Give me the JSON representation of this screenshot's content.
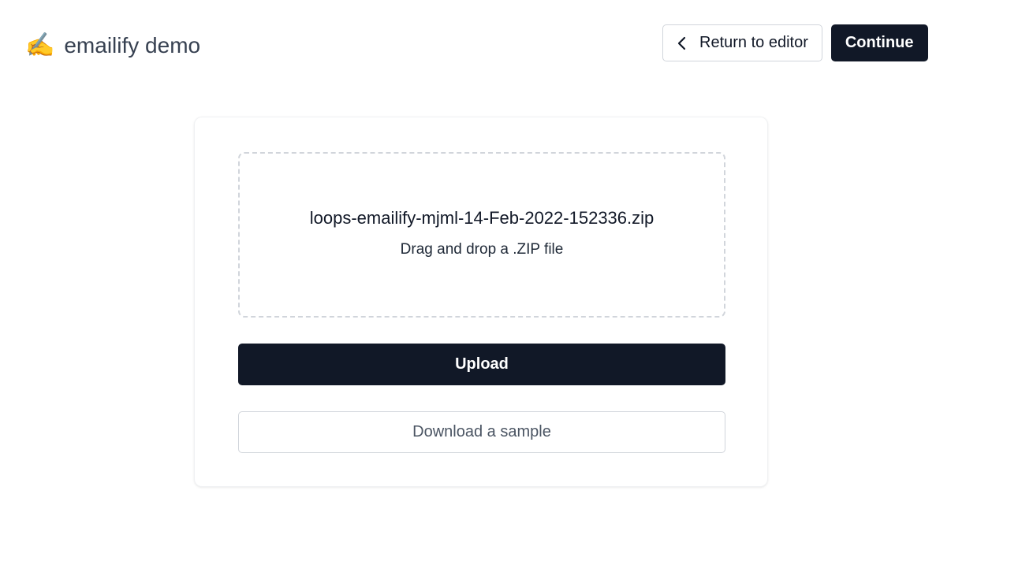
{
  "header": {
    "brand_icon": "writing-hand-icon",
    "brand_glyph": "✍️",
    "title": "emailify demo",
    "return_label": "Return to editor",
    "continue_label": "Continue"
  },
  "upload": {
    "filename": "loops-emailify-mjml-14-Feb-2022-152336.zip",
    "hint": "Drag and drop a .ZIP file",
    "upload_label": "Upload",
    "sample_label": "Download a sample"
  },
  "colors": {
    "primary": "#111827",
    "border": "#d1d5db",
    "muted_text": "#4b5563"
  }
}
